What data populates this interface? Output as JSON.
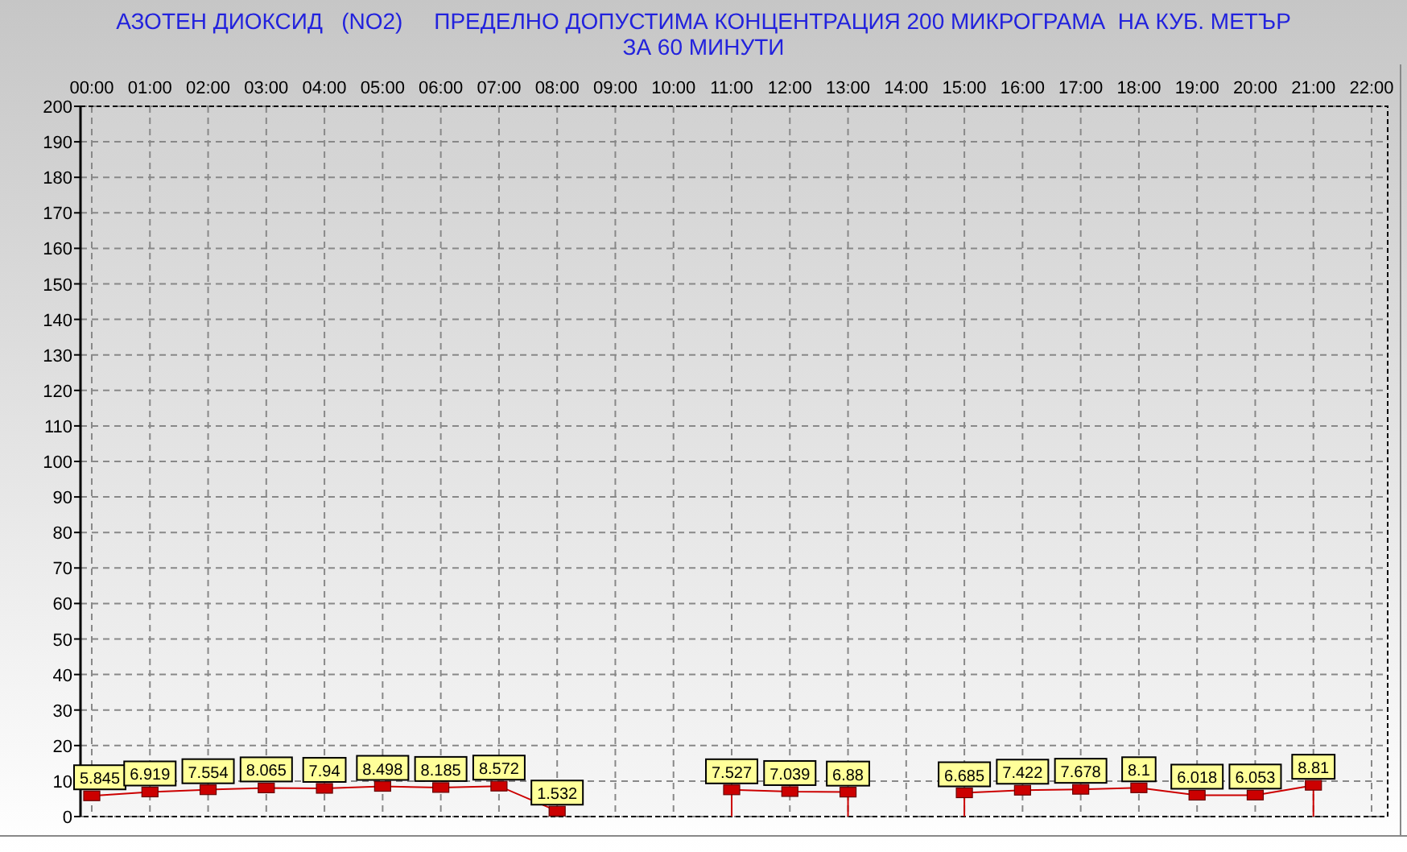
{
  "title_lines": [
    "АЗОТЕН ДИОКСИД   (NO2)     ПРЕДЕЛНО ДОПУСТИМА КОНЦЕНТРАЦИЯ 200 МИКРОГРАМА  НА КУБ. МЕТЪР",
    "ЗА 60 МИНУТИ"
  ],
  "chart_data": {
    "type": "line",
    "categories": [
      "00:00",
      "01:00",
      "02:00",
      "03:00",
      "04:00",
      "05:00",
      "06:00",
      "07:00",
      "08:00",
      "09:00",
      "10:00",
      "11:00",
      "12:00",
      "13:00",
      "14:00",
      "15:00",
      "16:00",
      "17:00",
      "18:00",
      "19:00",
      "20:00",
      "21:00",
      "22:00"
    ],
    "grid": true,
    "series": [
      {
        "color": "#cc0000",
        "marker": true,
        "values": [
          5.845,
          6.919,
          7.554,
          8.065,
          7.94,
          8.498,
          8.185,
          8.572,
          1.532,
          null,
          null,
          7.527,
          7.039,
          6.88,
          null,
          6.685,
          7.422,
          7.678,
          8.1,
          6.018,
          6.053,
          8.81,
          null
        ]
      }
    ],
    "value_labels": [
      "5.845",
      "6.919",
      "7.554",
      "8.065",
      "7.94",
      "8.498",
      "8.185",
      "8.572",
      "1.532",
      null,
      null,
      "7.527",
      "7.039",
      "6.88",
      null,
      "6.685",
      "7.422",
      "7.678",
      "8.1",
      "6.018",
      "6.053",
      "8.81",
      null
    ],
    "ylim": [
      0,
      200
    ],
    "yticks": [
      0,
      10,
      20,
      30,
      40,
      50,
      60,
      70,
      80,
      90,
      100,
      110,
      120,
      130,
      140,
      150,
      160,
      170,
      180,
      190,
      200
    ]
  }
}
